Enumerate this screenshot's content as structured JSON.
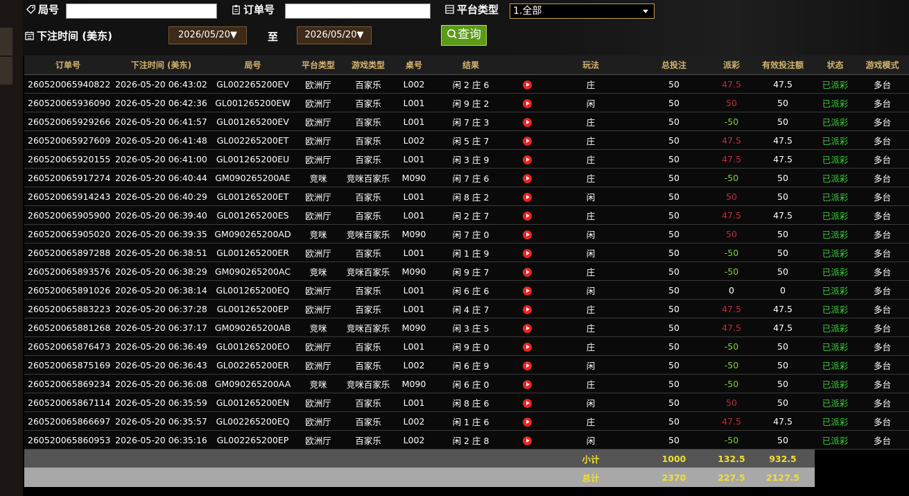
{
  "filters": {
    "game_no_label": "局号",
    "order_no_label": "订单号",
    "platform_label": "平台类型",
    "platform_value": "1.全部",
    "time_label": "下注时间 (美东)",
    "date_from": "2026/05/20▼",
    "to_label": "至",
    "date_to": "2026/05/20▼",
    "query_label": "查询"
  },
  "columns": [
    "订单号",
    "下注时间 (美东)",
    "局号",
    "平台类型",
    "游戏类型",
    "桌号",
    "结果",
    "",
    "玩法",
    "总投注",
    "派彩",
    "有效投注额",
    "状态",
    "游戏模式"
  ],
  "rows": [
    [
      "260520065940822",
      "2026-05-20 06:43:02",
      "GL002265200EV",
      "欧洲厅",
      "百家乐",
      "L002",
      "闲 2 庄 6",
      "庄",
      "50",
      "47.5",
      "47.5",
      "已派彩",
      "多台"
    ],
    [
      "260520065936090",
      "2026-05-20 06:42:36",
      "GL001265200EW",
      "欧洲厅",
      "百家乐",
      "L001",
      "闲 9 庄 2",
      "闲",
      "50",
      "50",
      "50",
      "已派彩",
      "多台"
    ],
    [
      "260520065929266",
      "2026-05-20 06:41:57",
      "GL001265200EV",
      "欧洲厅",
      "百家乐",
      "L001",
      "闲 7 庄 3",
      "庄",
      "50",
      "-50",
      "50",
      "已派彩",
      "多台"
    ],
    [
      "260520065927609",
      "2026-05-20 06:41:48",
      "GL002265200ET",
      "欧洲厅",
      "百家乐",
      "L002",
      "闲 5 庄 7",
      "庄",
      "50",
      "47.5",
      "47.5",
      "已派彩",
      "多台"
    ],
    [
      "260520065920155",
      "2026-05-20 06:41:00",
      "GL001265200EU",
      "欧洲厅",
      "百家乐",
      "L001",
      "闲 3 庄 9",
      "庄",
      "50",
      "47.5",
      "47.5",
      "已派彩",
      "多台"
    ],
    [
      "260520065917274",
      "2026-05-20 06:40:44",
      "GM090265200AE",
      "竞咪",
      "竞咪百家乐",
      "M090",
      "闲 7 庄 6",
      "庄",
      "50",
      "-50",
      "50",
      "已派彩",
      "多台"
    ],
    [
      "260520065914243",
      "2026-05-20 06:40:29",
      "GL001265200ET",
      "欧洲厅",
      "百家乐",
      "L001",
      "闲 8 庄 2",
      "闲",
      "50",
      "50",
      "50",
      "已派彩",
      "多台"
    ],
    [
      "260520065905900",
      "2026-05-20 06:39:40",
      "GL001265200ES",
      "欧洲厅",
      "百家乐",
      "L001",
      "闲 2 庄 7",
      "庄",
      "50",
      "47.5",
      "47.5",
      "已派彩",
      "多台"
    ],
    [
      "260520065905020",
      "2026-05-20 06:39:35",
      "GM090265200AD",
      "竞咪",
      "竞咪百家乐",
      "M090",
      "闲 7 庄 0",
      "闲",
      "50",
      "50",
      "50",
      "已派彩",
      "多台"
    ],
    [
      "260520065897288",
      "2026-05-20 06:38:51",
      "GL001265200ER",
      "欧洲厅",
      "百家乐",
      "L001",
      "闲 1 庄 9",
      "闲",
      "50",
      "-50",
      "50",
      "已派彩",
      "多台"
    ],
    [
      "260520065893576",
      "2026-05-20 06:38:29",
      "GM090265200AC",
      "竞咪",
      "竞咪百家乐",
      "M090",
      "闲 9 庄 7",
      "庄",
      "50",
      "-50",
      "50",
      "已派彩",
      "多台"
    ],
    [
      "260520065891026",
      "2026-05-20 06:38:14",
      "GL001265200EQ",
      "欧洲厅",
      "百家乐",
      "L001",
      "闲 6 庄 6",
      "闲",
      "50",
      "0",
      "0",
      "已派彩",
      "多台"
    ],
    [
      "260520065883223",
      "2026-05-20 06:37:28",
      "GL001265200EP",
      "欧洲厅",
      "百家乐",
      "L001",
      "闲 4 庄 7",
      "庄",
      "50",
      "47.5",
      "47.5",
      "已派彩",
      "多台"
    ],
    [
      "260520065881268",
      "2026-05-20 06:37:17",
      "GM090265200AB",
      "竞咪",
      "竞咪百家乐",
      "M090",
      "闲 3 庄 5",
      "庄",
      "50",
      "47.5",
      "47.5",
      "已派彩",
      "多台"
    ],
    [
      "260520065876473",
      "2026-05-20 06:36:49",
      "GL001265200EO",
      "欧洲厅",
      "百家乐",
      "L001",
      "闲 9 庄 0",
      "庄",
      "50",
      "-50",
      "50",
      "已派彩",
      "多台"
    ],
    [
      "260520065875169",
      "2026-05-20 06:36:43",
      "GL002265200ER",
      "欧洲厅",
      "百家乐",
      "L002",
      "闲 6 庄 9",
      "闲",
      "50",
      "-50",
      "50",
      "已派彩",
      "多台"
    ],
    [
      "260520065869234",
      "2026-05-20 06:36:08",
      "GM090265200AA",
      "竞咪",
      "竞咪百家乐",
      "M090",
      "闲 6 庄 0",
      "庄",
      "50",
      "-50",
      "50",
      "已派彩",
      "多台"
    ],
    [
      "260520065867114",
      "2026-05-20 06:35:59",
      "GL001265200EN",
      "欧洲厅",
      "百家乐",
      "L001",
      "闲 8 庄 6",
      "闲",
      "50",
      "50",
      "50",
      "已派彩",
      "多台"
    ],
    [
      "260520065866697",
      "2026-05-20 06:35:57",
      "GL002265200EQ",
      "欧洲厅",
      "百家乐",
      "L002",
      "闲 1 庄 6",
      "庄",
      "50",
      "47.5",
      "47.5",
      "已派彩",
      "多台"
    ],
    [
      "260520065860953",
      "2026-05-20 06:35:16",
      "GL002265200EP",
      "欧洲厅",
      "百家乐",
      "L002",
      "闲 2 庄 8",
      "闲",
      "50",
      "-50",
      "50",
      "已派彩",
      "多台"
    ]
  ],
  "subtotal": {
    "label": "小计",
    "bet": "1000",
    "payout": "132.5",
    "valid": "932.5"
  },
  "total": {
    "label": "总计",
    "bet": "2370",
    "payout": "227.5",
    "valid": "2127.5"
  },
  "colors": {
    "gold_header": "#d4b36d",
    "win_red": "#c8273a",
    "lose_green": "#7fd33a",
    "status_green": "#3ccf3c",
    "total_yellow": "#f0e030",
    "query_green": "#5b9b17"
  }
}
